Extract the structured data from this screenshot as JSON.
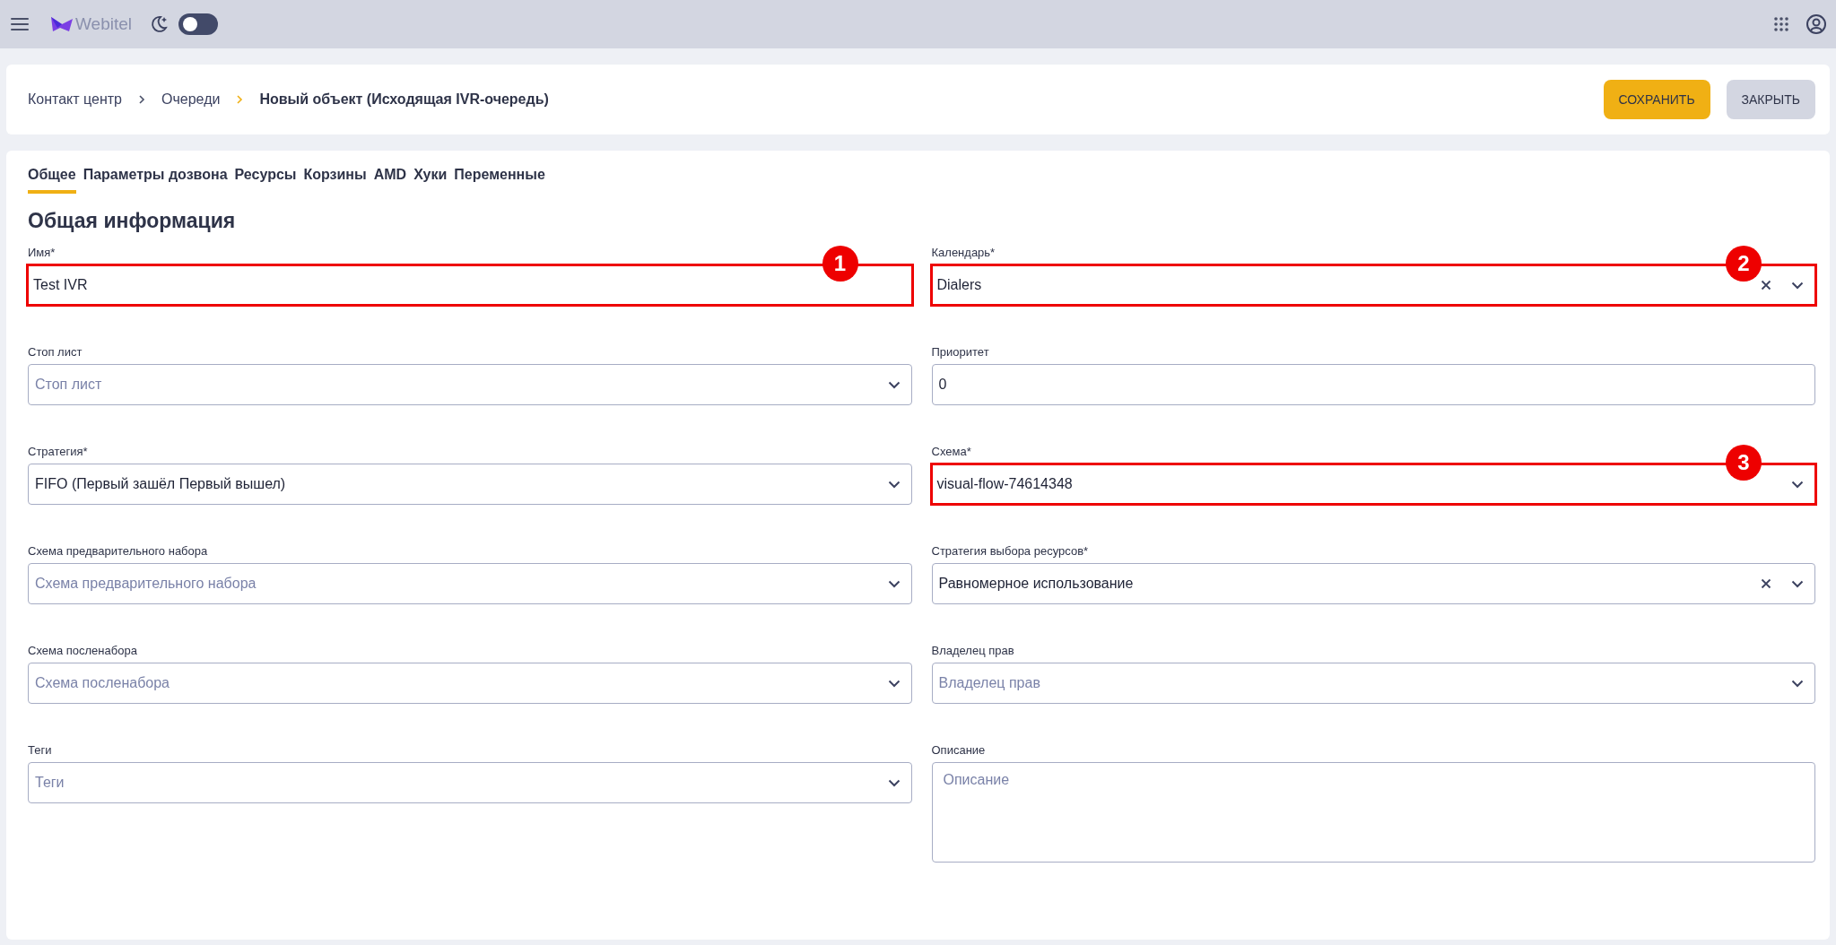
{
  "topbar": {
    "logo_text": "Webitel",
    "dark_mode": false
  },
  "breadcrumbs": [
    {
      "label": "Контакт центр",
      "current": false
    },
    {
      "label": "Очереди",
      "current": false
    },
    {
      "label": "Новый объект (Исходящая IVR-очередь)",
      "current": true
    }
  ],
  "buttons": [
    {
      "label": "СОХРАНИТЬ",
      "kind": "primary"
    },
    {
      "label": "ЗАКРЫТЬ",
      "kind": "secondary"
    }
  ],
  "tabs": [
    {
      "label": "Общее",
      "selected": true
    },
    {
      "label": "Параметры дозвона",
      "selected": false
    },
    {
      "label": "Ресурсы",
      "selected": false
    },
    {
      "label": "Корзины",
      "selected": false
    },
    {
      "label": "AMD",
      "selected": false
    },
    {
      "label": "Хуки",
      "selected": false
    },
    {
      "label": "Переменные",
      "selected": false
    }
  ],
  "section_title": "Общая информация",
  "fields": [
    {
      "label": "Имя*",
      "kind": "text",
      "value": "Test IVR",
      "highlighted": true,
      "marker": "1"
    },
    {
      "label": "Календарь*",
      "kind": "select",
      "value": "Dialers",
      "clearable": true,
      "highlighted": true,
      "marker": "2"
    },
    {
      "label": "Стоп лист",
      "kind": "select",
      "placeholder": "Стоп лист",
      "clearable": false,
      "highlighted": false
    },
    {
      "label": "Приоритет",
      "kind": "text",
      "value": "0",
      "highlighted": false
    },
    {
      "label": "Стратегия*",
      "kind": "select",
      "value": "FIFO (Первый зашёл Первый вышел)",
      "clearable": false,
      "highlighted": false
    },
    {
      "label": "Схема*",
      "kind": "select",
      "value": "visual-flow-74614348",
      "clearable": false,
      "highlighted": true,
      "marker": "3"
    },
    {
      "label": "Схема предварительного набора",
      "kind": "select",
      "placeholder": "Схема предварительного набора",
      "clearable": false,
      "highlighted": false
    },
    {
      "label": "Стратегия выбора ресурсов*",
      "kind": "select",
      "value": "Равномерное использование",
      "clearable": true,
      "highlighted": false
    },
    {
      "label": "Схема посленабора",
      "kind": "select",
      "placeholder": "Схема посленабора",
      "clearable": false,
      "highlighted": false
    },
    {
      "label": "Владелец прав",
      "kind": "select",
      "placeholder": "Владелец прав",
      "clearable": false,
      "highlighted": false
    },
    {
      "label": "Теги",
      "kind": "select",
      "placeholder": "Теги",
      "clearable": false,
      "highlighted": false
    },
    {
      "label": "Описание",
      "kind": "textarea",
      "placeholder": "Описание",
      "highlighted": false
    }
  ]
}
